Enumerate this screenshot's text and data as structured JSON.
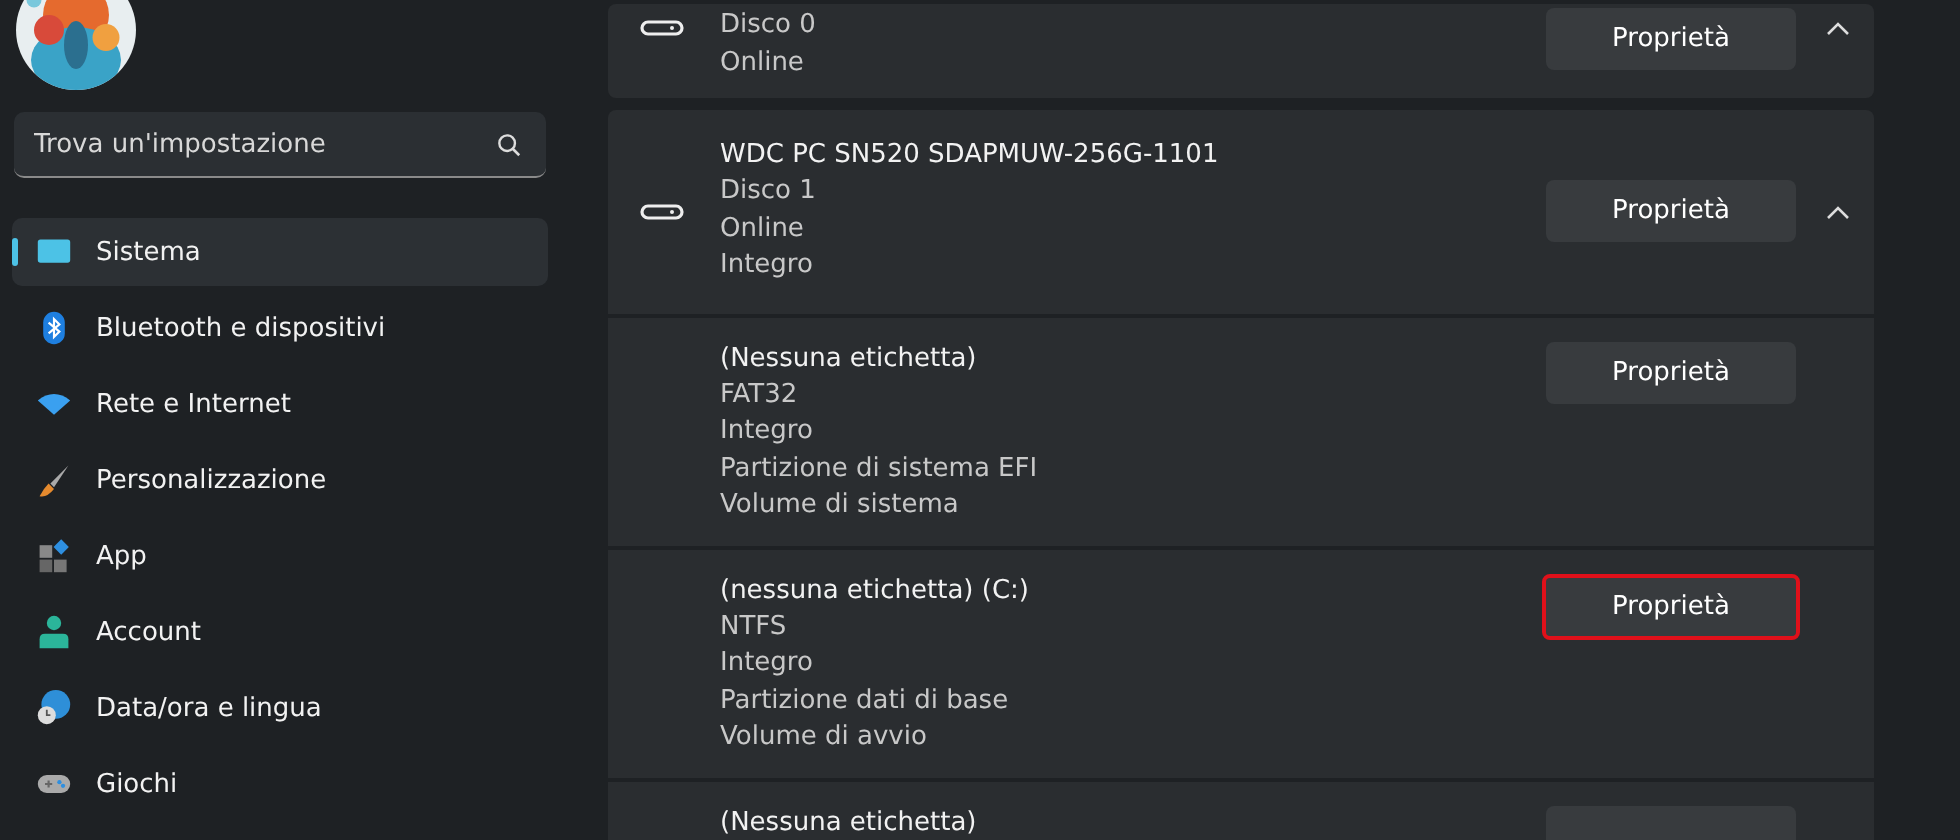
{
  "sidebar": {
    "search": {
      "placeholder": "Trova un'impostazione"
    },
    "items": [
      {
        "label": "Sistema",
        "kind": "system",
        "selected": true
      },
      {
        "label": "Bluetooth e dispositivi",
        "kind": "bluetooth",
        "selected": false
      },
      {
        "label": "Rete e Internet",
        "kind": "network",
        "selected": false
      },
      {
        "label": "Personalizzazione",
        "kind": "brush",
        "selected": false
      },
      {
        "label": "App",
        "kind": "apps",
        "selected": false
      },
      {
        "label": "Account",
        "kind": "account",
        "selected": false
      },
      {
        "label": "Data/ora e lingua",
        "kind": "time",
        "selected": false
      },
      {
        "label": "Giochi",
        "kind": "games",
        "selected": false
      }
    ]
  },
  "disks": [
    {
      "lines": [
        "Disco 0",
        "Online"
      ],
      "button": "Proprietà",
      "expanded": true
    },
    {
      "title": "WDC PC SN520 SDAPMUW-256G-1101",
      "lines": [
        "Disco 1",
        "Online",
        "Integro"
      ],
      "button": "Proprietà",
      "expanded": true,
      "partitions": [
        {
          "title": "(Nessuna etichetta)",
          "lines": [
            "FAT32",
            "Integro",
            "Partizione di sistema EFI",
            "Volume di sistema"
          ],
          "button": "Proprietà",
          "highlighted": false
        },
        {
          "title": "(nessuna etichetta) (C:)",
          "lines": [
            "NTFS",
            "Integro",
            "Partizione dati di base",
            "Volume di avvio"
          ],
          "button": "Proprietà",
          "highlighted": true
        },
        {
          "title": "(Nessuna etichetta)",
          "highlighted": false
        }
      ]
    }
  ]
}
